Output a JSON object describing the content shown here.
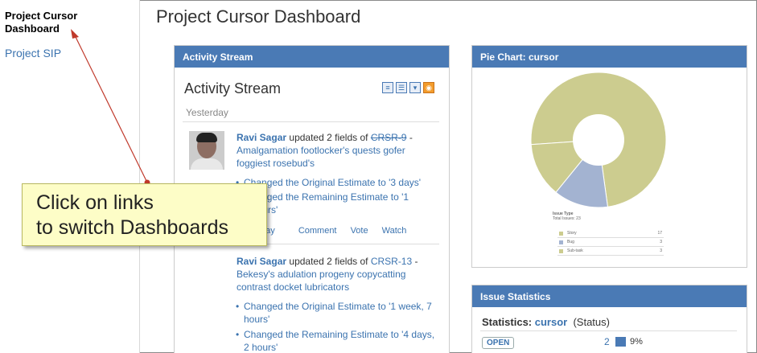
{
  "sidebar": {
    "active_item": "Project Cursor Dashboard",
    "items": [
      "Project SIP"
    ]
  },
  "page": {
    "title": "Project Cursor Dashboard"
  },
  "activity_gadget": {
    "header": "Activity Stream",
    "title": "Activity Stream",
    "icons": [
      "list-view-icon",
      "full-view-icon",
      "filter-icon",
      "rss-icon"
    ],
    "group_label": "Yesterday",
    "entries": [
      {
        "user": "Ravi Sagar",
        "verb": "updated 2 fields of",
        "issue_key": "CRSR-9",
        "issue_key_strikethrough": true,
        "summary": "Amalgamation footlocker's quests gofer foggiest rosebud's",
        "changes": [
          "Changed the Original Estimate to '3 days'",
          "Changed the Remaining Estimate to '1",
          "hours'"
        ],
        "actions": [
          "day",
          "Comment",
          "Vote",
          "Watch"
        ]
      },
      {
        "user": "Ravi Sagar",
        "verb": "updated 2 fields of",
        "issue_key": "CRSR-13",
        "summary": "Bekesy's adulation progeny copycatting contrast docket lubricators",
        "changes": [
          "Changed the Original Estimate to '1 week, 7 hours'",
          "Changed the Remaining Estimate to '4 days, 2 hours'"
        ]
      }
    ]
  },
  "pie_gadget": {
    "header": "Pie Chart: cursor",
    "chart_data": {
      "type": "pie",
      "categories": [
        "Story",
        "Bug",
        "Sub-task"
      ],
      "values": [
        17,
        3,
        3
      ],
      "legend_title": "Issue Type",
      "legend_subtitle": "Total Issues: 23",
      "colors": [
        "#cccc8f",
        "#a3b3d1",
        "#cccc8f"
      ],
      "legend_placement": "bottom"
    }
  },
  "stats_gadget": {
    "header": "Issue Statistics",
    "label": "Statistics:",
    "filter_name": "cursor",
    "stat_type": "(Status)",
    "rows": [
      {
        "status": "OPEN",
        "count": "2",
        "percent": "9%"
      }
    ]
  },
  "callout": {
    "line1": "Click on links",
    "line2": "to switch Dashboards"
  },
  "colors": {
    "accent": "#4a7ab5",
    "link": "#3b73af",
    "callout_bg": "#fdfdc7",
    "arrow": "#c0392b"
  }
}
